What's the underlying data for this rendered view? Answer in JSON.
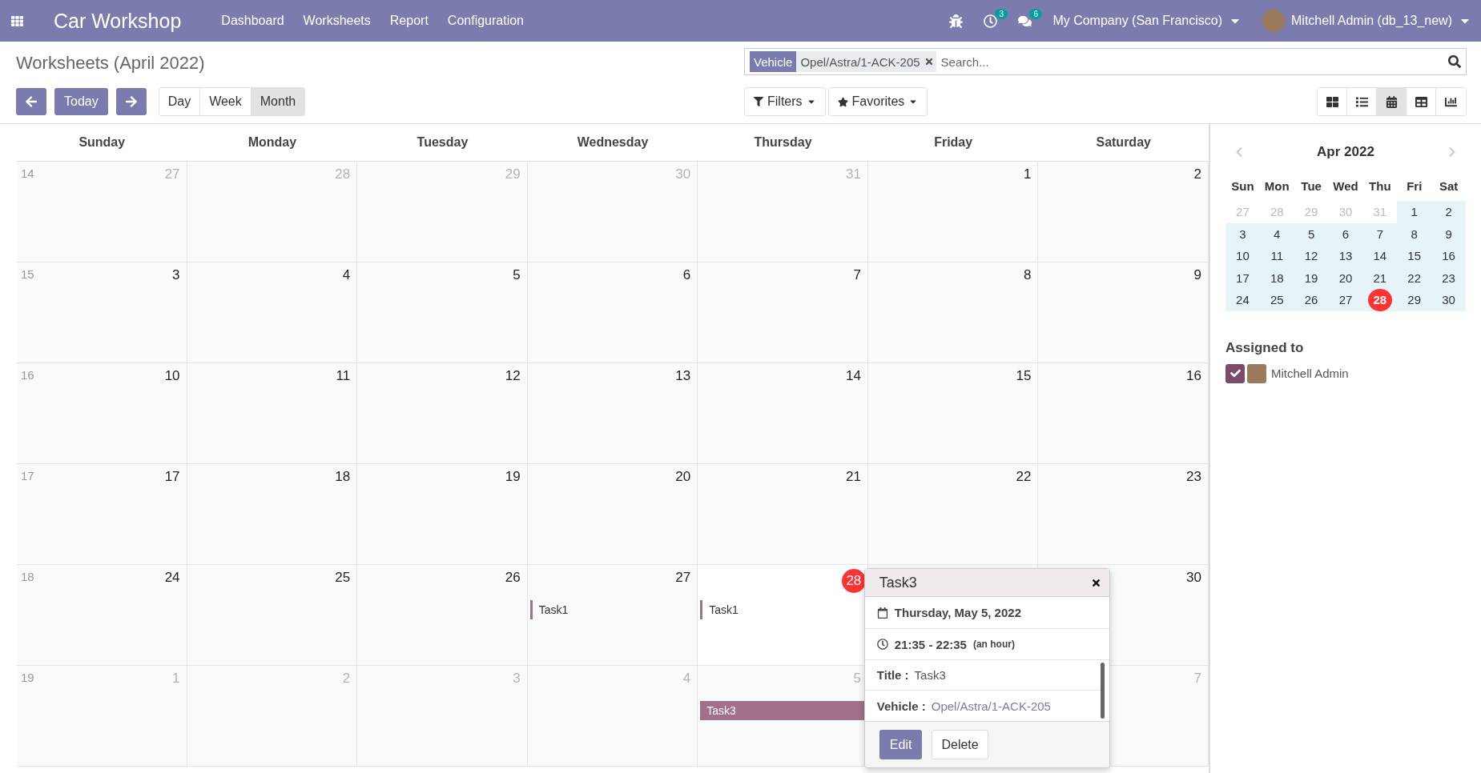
{
  "navbar": {
    "app_name": "Car Workshop",
    "menus": [
      "Dashboard",
      "Worksheets",
      "Report",
      "Configuration"
    ],
    "activity_count": "3",
    "message_count": "6",
    "company": "My Company (San Francisco)",
    "user": "Mitchell Admin (db_13_new)"
  },
  "control_panel": {
    "title": "Worksheets (April 2022)",
    "today_button": "Today",
    "scales": [
      {
        "label": "Day",
        "selected": false
      },
      {
        "label": "Week",
        "selected": false
      },
      {
        "label": "Month",
        "selected": true
      }
    ],
    "search": {
      "facet_label": "Vehicle",
      "facet_value": "Opel/Astra/1-ACK-205",
      "placeholder": "Search..."
    },
    "filters": "Filters",
    "favorites": "Favorites",
    "views": [
      {
        "kind": "kanban",
        "selected": false
      },
      {
        "kind": "list",
        "selected": false
      },
      {
        "kind": "calendar",
        "selected": true
      },
      {
        "kind": "pivot",
        "selected": false
      },
      {
        "kind": "graph",
        "selected": false
      }
    ]
  },
  "calendar": {
    "weekdays": [
      "Sunday",
      "Monday",
      "Tuesday",
      "Wednesday",
      "Thursday",
      "Friday",
      "Saturday"
    ],
    "weeks": [
      {
        "week": "14",
        "days": [
          {
            "day": "27",
            "muted": true,
            "today": false
          },
          {
            "day": "28",
            "muted": true,
            "today": false
          },
          {
            "day": "29",
            "muted": true,
            "today": false
          },
          {
            "day": "30",
            "muted": true,
            "today": false
          },
          {
            "day": "31",
            "muted": true,
            "today": false
          },
          {
            "day": "1",
            "muted": false,
            "today": false
          },
          {
            "day": "2",
            "muted": false,
            "today": false
          }
        ]
      },
      {
        "week": "15",
        "days": [
          {
            "day": "3",
            "muted": false,
            "today": false
          },
          {
            "day": "4",
            "muted": false,
            "today": false
          },
          {
            "day": "5",
            "muted": false,
            "today": false
          },
          {
            "day": "6",
            "muted": false,
            "today": false
          },
          {
            "day": "7",
            "muted": false,
            "today": false
          },
          {
            "day": "8",
            "muted": false,
            "today": false
          },
          {
            "day": "9",
            "muted": false,
            "today": false
          }
        ]
      },
      {
        "week": "16",
        "days": [
          {
            "day": "10",
            "muted": false,
            "today": false
          },
          {
            "day": "11",
            "muted": false,
            "today": false
          },
          {
            "day": "12",
            "muted": false,
            "today": false
          },
          {
            "day": "13",
            "muted": false,
            "today": false
          },
          {
            "day": "14",
            "muted": false,
            "today": false
          },
          {
            "day": "15",
            "muted": false,
            "today": false
          },
          {
            "day": "16",
            "muted": false,
            "today": false
          }
        ]
      },
      {
        "week": "17",
        "days": [
          {
            "day": "17",
            "muted": false,
            "today": false
          },
          {
            "day": "18",
            "muted": false,
            "today": false
          },
          {
            "day": "19",
            "muted": false,
            "today": false
          },
          {
            "day": "20",
            "muted": false,
            "today": false
          },
          {
            "day": "21",
            "muted": false,
            "today": false
          },
          {
            "day": "22",
            "muted": false,
            "today": false
          },
          {
            "day": "23",
            "muted": false,
            "today": false
          }
        ]
      },
      {
        "week": "18",
        "days": [
          {
            "day": "24",
            "muted": false,
            "today": false
          },
          {
            "day": "25",
            "muted": false,
            "today": false
          },
          {
            "day": "26",
            "muted": false,
            "today": false
          },
          {
            "day": "27",
            "muted": false,
            "today": false,
            "events": [
              {
                "kind": "bar",
                "title": "Task1"
              }
            ]
          },
          {
            "day": "28",
            "muted": false,
            "today": true,
            "events": [
              {
                "kind": "bar",
                "title": "Task1"
              }
            ]
          },
          {
            "day": "30",
            "muted": false,
            "today": false
          }
        ]
      },
      {
        "week": "19",
        "days": [
          {
            "day": "1",
            "muted": true,
            "today": false
          },
          {
            "day": "2",
            "muted": true,
            "today": false
          },
          {
            "day": "3",
            "muted": true,
            "today": false
          },
          {
            "day": "4",
            "muted": true,
            "today": false
          },
          {
            "day": "5",
            "muted": true,
            "today": false,
            "events": [
              {
                "kind": "block",
                "title": "Task3"
              }
            ]
          },
          {
            "day": "7",
            "muted": true,
            "today": false
          }
        ]
      }
    ]
  },
  "popover": {
    "title": "Task3",
    "date": "Thursday, May 5, 2022",
    "time": "21:35 - 22:35",
    "duration": "(an hour)",
    "fields": [
      {
        "label": "Title :",
        "value": "Task3",
        "kind": "text"
      },
      {
        "label": "Vehicle :",
        "value": "Opel/Astra/1-ACK-205",
        "kind": "link"
      }
    ],
    "edit": "Edit",
    "delete": "Delete"
  },
  "sidebar": {
    "month": "Apr 2022",
    "weekdays": [
      "Sun",
      "Mon",
      "Tue",
      "Wed",
      "Thu",
      "Fri",
      "Sat"
    ],
    "weeks": [
      [
        {
          "day": "27",
          "muted": true,
          "today": false
        },
        {
          "day": "28",
          "muted": true,
          "today": false
        },
        {
          "day": "29",
          "muted": true,
          "today": false
        },
        {
          "day": "30",
          "muted": true,
          "today": false
        },
        {
          "day": "31",
          "muted": true,
          "today": false
        },
        {
          "day": "1",
          "muted": false,
          "today": false
        },
        {
          "day": "2",
          "muted": false,
          "today": false
        }
      ],
      [
        {
          "day": "3",
          "muted": false,
          "today": false
        },
        {
          "day": "4",
          "muted": false,
          "today": false
        },
        {
          "day": "5",
          "muted": false,
          "today": false
        },
        {
          "day": "6",
          "muted": false,
          "today": false
        },
        {
          "day": "7",
          "muted": false,
          "today": false
        },
        {
          "day": "8",
          "muted": false,
          "today": false
        },
        {
          "day": "9",
          "muted": false,
          "today": false
        }
      ],
      [
        {
          "day": "10",
          "muted": false,
          "today": false
        },
        {
          "day": "11",
          "muted": false,
          "today": false
        },
        {
          "day": "12",
          "muted": false,
          "today": false
        },
        {
          "day": "13",
          "muted": false,
          "today": false
        },
        {
          "day": "14",
          "muted": false,
          "today": false
        },
        {
          "day": "15",
          "muted": false,
          "today": false
        },
        {
          "day": "16",
          "muted": false,
          "today": false
        }
      ],
      [
        {
          "day": "17",
          "muted": false,
          "today": false
        },
        {
          "day": "18",
          "muted": false,
          "today": false
        },
        {
          "day": "19",
          "muted": false,
          "today": false
        },
        {
          "day": "20",
          "muted": false,
          "today": false
        },
        {
          "day": "21",
          "muted": false,
          "today": false
        },
        {
          "day": "22",
          "muted": false,
          "today": false
        },
        {
          "day": "23",
          "muted": false,
          "today": false
        }
      ],
      [
        {
          "day": "24",
          "muted": false,
          "today": false
        },
        {
          "day": "25",
          "muted": false,
          "today": false
        },
        {
          "day": "26",
          "muted": false,
          "today": false
        },
        {
          "day": "27",
          "muted": false,
          "today": false
        },
        {
          "day": "28",
          "muted": false,
          "today": true
        },
        {
          "day": "29",
          "muted": false,
          "today": false
        },
        {
          "day": "30",
          "muted": false,
          "today": false
        }
      ]
    ],
    "filter_title": "Assigned to",
    "attendees": [
      {
        "name": "Mitchell Admin",
        "checked": true
      }
    ]
  }
}
